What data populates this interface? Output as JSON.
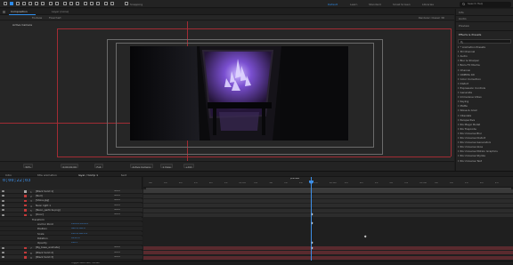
{
  "toolbar": {
    "snapping_label": "Snapping",
    "workspaces": [
      "Default",
      "Learn",
      "Standard",
      "Small Screen",
      "Libraries"
    ],
    "active_workspace": "Default",
    "search_placeholder": "Search Help"
  },
  "viewer": {
    "tab_label": "Composition",
    "sub_tabs": [
      "Layer (none)",
      "Footage",
      "Flowchart"
    ],
    "renderer_label": "Renderer: Classic 3D",
    "camera_label": "Active Camera",
    "footer": {
      "zoom": "50%",
      "timecode": "0;00;01;00",
      "resolution": "Full",
      "view": "Active Camera",
      "views_count": "1 View",
      "offset": "+0.0"
    }
  },
  "right_panel": {
    "sections": [
      "Info",
      "Audio",
      "Preview",
      "Effects & Presets"
    ],
    "search_placeholder": "",
    "effects": [
      "* Animation Presets",
      "3D Channel",
      "Audio",
      "Blur & Sharpen",
      "Boris FX Mocha",
      "Channel",
      "CINEMA 4D",
      "Color Correction",
      "Distort",
      "Expression Controls",
      "Generate",
      "Immersive Video",
      "Keying",
      "Matte",
      "Noise & Grain",
      "Obsolete",
      "Perspective",
      "RG Magic Bullet",
      "RG Trapcode",
      "RG Universe Blur",
      "RG Universe Distort",
      "RG Universe Generators",
      "RG Universe Glow",
      "RG Universe Motion Graphics",
      "RG Universe Stylize",
      "RG Universe Text"
    ]
  },
  "timeline": {
    "tabs": [
      "Intro",
      "title animation",
      "layer / Comp 1",
      "text"
    ],
    "timecode": "0;00;22;03",
    "ruler_ticks": [
      "00f",
      "05f",
      "10f",
      "15f",
      "20f",
      "25f",
      "01:00f",
      "05f",
      "10f",
      "15f",
      "20f",
      "25f",
      "02:00f",
      "05f",
      "10f",
      "15f",
      "20f",
      "25f",
      "03:00f",
      "05f",
      "10f",
      "15f",
      "20f",
      "25f"
    ],
    "playhead_label": "preview",
    "layers": [
      {
        "index": "1",
        "name": "[Black Solid 1]",
        "color": "#a6a6a6",
        "mode": "None",
        "type": "layer"
      },
      {
        "index": "2",
        "name": "[Null]",
        "color": "#c13a3a",
        "mode": "None",
        "type": "layer"
      },
      {
        "index": "3",
        "name": "[Shine.jpg]",
        "color": "#c13a3a",
        "mode": "None",
        "type": "layer"
      },
      {
        "index": "4",
        "name": "Neon light 1",
        "color": "#c13a3a",
        "mode": "None",
        "type": "layer"
      },
      {
        "index": "5",
        "name": "[Neon_particle.png]",
        "color": "#c13a3a",
        "mode": "None",
        "type": "layer"
      },
      {
        "index": "6",
        "name": "[Door]",
        "color": "#c13a3a",
        "mode": "None",
        "type": "layer"
      },
      {
        "index": "",
        "name": "Transform",
        "color": "",
        "mode": "",
        "type": "group"
      },
      {
        "index": "",
        "name": "Anchor Point",
        "color": "",
        "mode": "",
        "type": "prop",
        "value": "1000.0,1024.0"
      },
      {
        "index": "",
        "name": "Position",
        "color": "",
        "mode": "",
        "type": "prop",
        "value": "960.0,540.0"
      },
      {
        "index": "",
        "name": "Scale",
        "color": "",
        "mode": "",
        "type": "prop",
        "value": "100.0,100.0%"
      },
      {
        "index": "",
        "name": "Rotation",
        "color": "",
        "mode": "",
        "type": "prop",
        "value": "0x+0.0°"
      },
      {
        "index": "",
        "name": "Opacity",
        "color": "",
        "mode": "",
        "type": "prop",
        "value": "100%"
      },
      {
        "index": "7",
        "name": "[Bg_base_animate]",
        "color": "#c13a3a",
        "mode": "None",
        "type": "layer"
      },
      {
        "index": "8",
        "name": "[Black Solid 2]",
        "color": "#c13a3a",
        "mode": "None",
        "type": "layer"
      },
      {
        "index": "9",
        "name": "[Black Solid 3]",
        "color": "#c13a3a",
        "mode": "None",
        "type": "layer"
      }
    ],
    "footer_label": "Toggle Switches / Modes"
  },
  "colors": {
    "accent": "#2d8ceb",
    "guide": "#a22c34",
    "crystal": "#8a5fe0"
  }
}
